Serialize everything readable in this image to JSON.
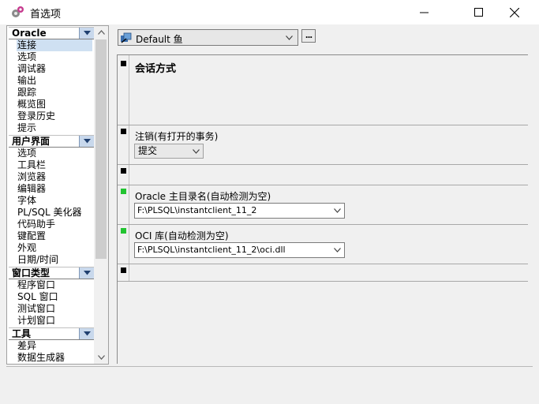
{
  "window": {
    "title": "首选项"
  },
  "tree": {
    "categories": [
      {
        "label": "Oracle",
        "items": [
          "连接",
          "选项",
          "调试器",
          "输出",
          "跟踪",
          "概览图",
          "登录历史",
          "提示"
        ]
      },
      {
        "label": "用户界面",
        "items": [
          "选项",
          "工具栏",
          "浏览器",
          "编辑器",
          "字体",
          "PL/SQL 美化器",
          "代码助手",
          "键配置",
          "外观",
          "日期/时间"
        ]
      },
      {
        "label": "窗口类型",
        "items": [
          "程序窗口",
          "SQL 窗口",
          "测试窗口",
          "计划窗口"
        ]
      },
      {
        "label": "工具",
        "items": [
          "差异",
          "数据生成器"
        ]
      }
    ],
    "selected": "连接"
  },
  "profile": {
    "value": "Default 鱼",
    "more_label": "..."
  },
  "settings": {
    "session_mode_label": "会话方式",
    "logoff_label": "注销(有打开的事务)",
    "logoff_value": "提交",
    "oracle_home_label": "Oracle 主目录名(自动检测为空)",
    "oracle_home_value": "F:\\PLSQL\\instantclient_11_2",
    "oci_label": "OCI 库(自动检测为空)",
    "oci_value": "F:\\PLSQL\\instantclient_11_2\\oci.dll"
  },
  "colors": {
    "green_marker": "#22c431",
    "selected_bg": "#cfe0f2"
  }
}
